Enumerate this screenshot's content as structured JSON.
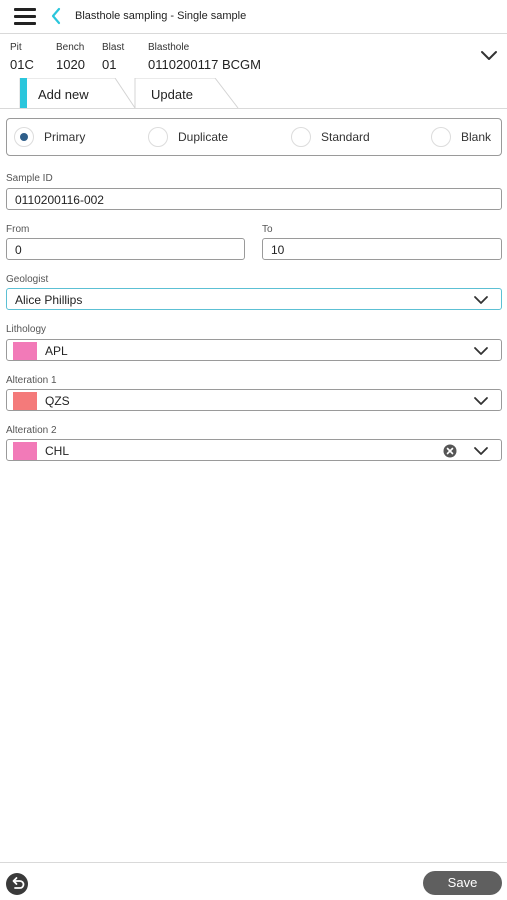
{
  "header": {
    "title": "Blasthole sampling - Single sample"
  },
  "context": {
    "pit_label": "Pit",
    "pit_value": "01C",
    "bench_label": "Bench",
    "bench_value": "1020",
    "blast_label": "Blast",
    "blast_value": "01",
    "blasthole_label": "Blasthole",
    "blasthole_value": "0110200117 BCGM"
  },
  "tabs": {
    "add_new": "Add new",
    "update": "Update",
    "active": "Add new"
  },
  "sample_type": {
    "options": [
      "Primary",
      "Duplicate",
      "Standard",
      "Blank"
    ],
    "selected": "Primary"
  },
  "form": {
    "sample_id": {
      "label": "Sample ID",
      "value": "0110200116-002"
    },
    "from": {
      "label": "From",
      "value": "0"
    },
    "to": {
      "label": "To",
      "value": "10"
    },
    "geologist": {
      "label": "Geologist",
      "value": "Alice Phillips"
    },
    "lithology": {
      "label": "Lithology",
      "value": "APL",
      "swatch_color": "#f27ab8"
    },
    "alteration1": {
      "label": "Alteration 1",
      "value": "QZS",
      "swatch_color": "#f47a7a"
    },
    "alteration2": {
      "label": "Alteration 2",
      "value": "CHL",
      "swatch_color": "#f27ab8"
    }
  },
  "footer": {
    "save_label": "Save"
  },
  "colors": {
    "accent": "#2bc6dc",
    "radio_selected": "#2f5f8a",
    "save_button": "#5f5f5f"
  }
}
